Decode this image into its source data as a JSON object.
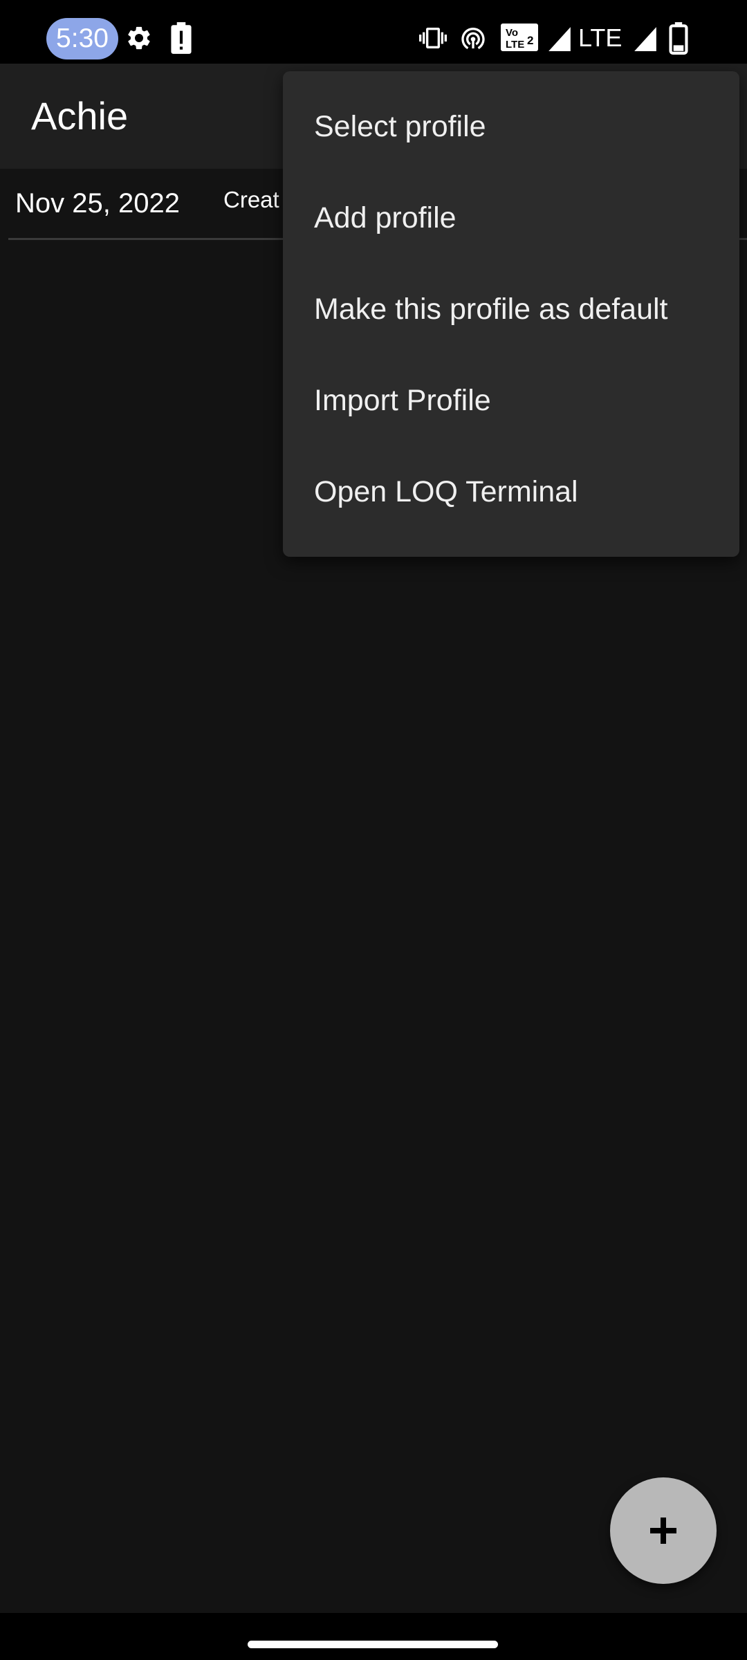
{
  "status_bar": {
    "time": "5:30",
    "network": "LTE",
    "icons": [
      "settings-icon",
      "battery-alert-icon",
      "vibrate-icon",
      "hotspot-icon",
      "volte-icon",
      "signal-icon",
      "signal-icon",
      "battery-icon"
    ]
  },
  "app_bar": {
    "title": "Achie"
  },
  "list": {
    "rows": [
      {
        "date": "Nov 25, 2022",
        "status": "Creat"
      }
    ]
  },
  "menu": {
    "items": [
      {
        "label": "Select profile"
      },
      {
        "label": "Add profile"
      },
      {
        "label": "Make this profile as default"
      },
      {
        "label": "Import Profile"
      },
      {
        "label": "Open LOQ Terminal"
      }
    ]
  },
  "fab": {
    "icon": "plus-icon"
  },
  "colors": {
    "time_pill": "#8da6e8",
    "app_bar": "#1f1f1f",
    "background": "#131313",
    "menu": "#2c2c2c",
    "fab": "#b8b8b8"
  }
}
